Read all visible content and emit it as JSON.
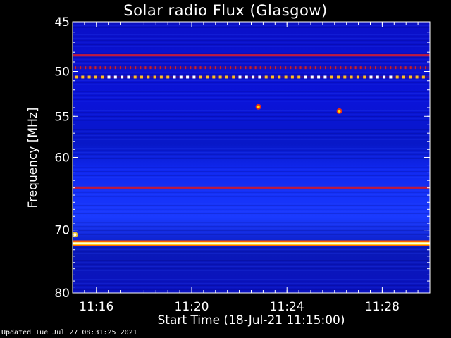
{
  "chart_data": {
    "type": "heatmap",
    "title": "Solar radio Flux (Glasgow)",
    "xlabel": "Start Time (18-Jul-21 11:15:00)",
    "ylabel": "Frequency [MHz]",
    "x_ticks": [
      "11:16",
      "11:20",
      "11:24",
      "11:28"
    ],
    "x_tick_minutes": [
      1,
      5,
      9,
      13
    ],
    "x_range_minutes": [
      0,
      15
    ],
    "y_ticks": [
      45,
      50,
      55,
      60,
      70,
      80
    ],
    "ylim": [
      45,
      80
    ],
    "y_scale": "log",
    "grid": false,
    "colorscale": [
      "#000030",
      "#0000c8",
      "#2030ff",
      "#b00040",
      "#ff2000",
      "#ffd000",
      "#ffffff"
    ],
    "features": [
      {
        "kind": "band",
        "freq": 48.3,
        "level": "red"
      },
      {
        "kind": "band",
        "freq": 64.0,
        "level": "red"
      },
      {
        "kind": "band",
        "freq": 72.0,
        "level": "yellow"
      },
      {
        "kind": "dashed-band",
        "freq": 49.6,
        "level": "red"
      },
      {
        "kind": "dashed-band",
        "freq": 50.6,
        "level": "yellow"
      },
      {
        "kind": "spot",
        "minute": 7.8,
        "freq": 53.9,
        "level": "red"
      },
      {
        "kind": "spot",
        "minute": 11.2,
        "freq": 54.4,
        "level": "red"
      },
      {
        "kind": "spot",
        "minute": 0.1,
        "freq": 70.7,
        "level": "white"
      }
    ]
  },
  "footer": {
    "updated": "Updated Tue Jul 27 08:31:25 2021"
  }
}
